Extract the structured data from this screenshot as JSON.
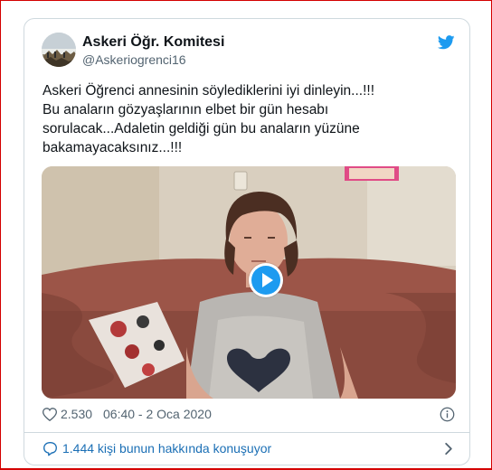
{
  "author": {
    "name": "Askeri Öğr. Komitesi",
    "handle": "@Askeriogrenci16"
  },
  "tweet": {
    "lines": [
      "Askeri Öğrenci annesinin söylediklerini iyi dinleyin...!!!",
      "Bu anaların gözyaşlarının elbet bir gün hesabı",
      "sorulacak...Adaletin geldiği gün bu anaların yüzüne",
      "bakamayacaksınız...!!!"
    ]
  },
  "media": {
    "type": "video",
    "description_icon": "play-icon"
  },
  "meta": {
    "likes": "2.530",
    "time": "06:40 - 2 Oca 2020"
  },
  "footer": {
    "conversation_label": "1.444 kişi bunun hakkında konuşuyor"
  },
  "colors": {
    "accent": "#1d9bf0",
    "frame": "#d40000",
    "link": "#1b6fb5",
    "muted": "#536471"
  }
}
